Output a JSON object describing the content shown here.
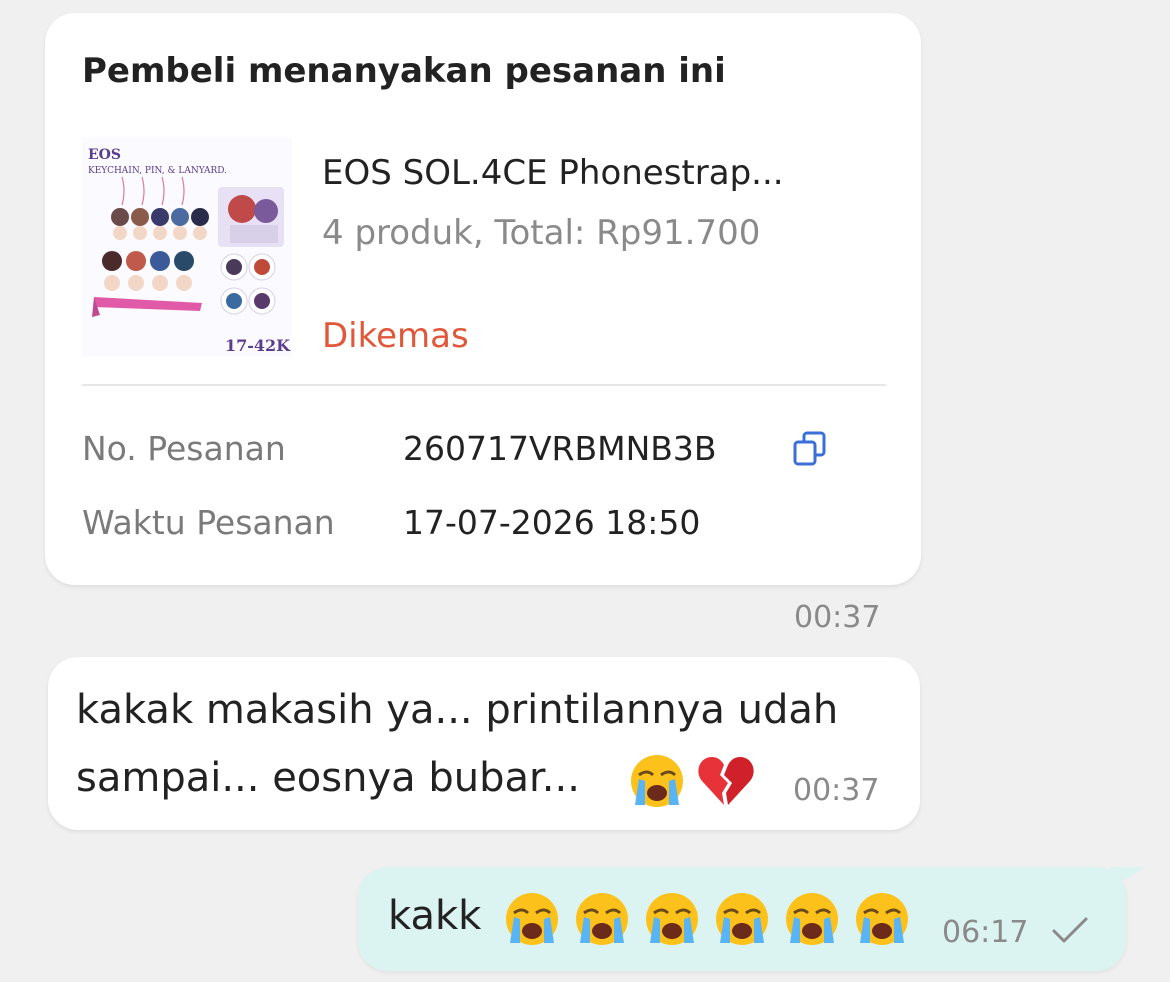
{
  "order_card": {
    "title": "Pembeli menanyakan pesanan ini",
    "product": {
      "image_title": "EOS",
      "image_subtitle": "KEYCHAIN, PIN, & LANYARD.",
      "image_price": "17-42K",
      "name": "EOS SOL.4CE Phonestrap...",
      "summary": "4 produk, Total: Rp91.700",
      "status": "Dikemas"
    },
    "fields": [
      {
        "label": "No. Pesanan",
        "value": "260717VRBMNB3B"
      },
      {
        "label": "Waktu Pesanan",
        "value": "17-07-2026 18:50"
      }
    ],
    "time": "00:37"
  },
  "incoming_message": {
    "line1": "kakak makasih ya... printilannya udah",
    "line2": "sampai... eosnya bubar...",
    "emojis": [
      "loudly-crying-face",
      "broken-heart"
    ],
    "time": "00:37"
  },
  "outgoing_message": {
    "text": "kakk",
    "emojis": [
      "loudly-crying-face",
      "loudly-crying-face",
      "loudly-crying-face",
      "loudly-crying-face",
      "loudly-crying-face",
      "loudly-crying-face"
    ],
    "time": "06:17",
    "status_icon": "check-icon"
  },
  "colors": {
    "background": "#f0f0f0",
    "status_orange": "#e0583a",
    "copy_blue": "#3b6fd8",
    "outgoing_bubble": "#dcf4f1"
  }
}
